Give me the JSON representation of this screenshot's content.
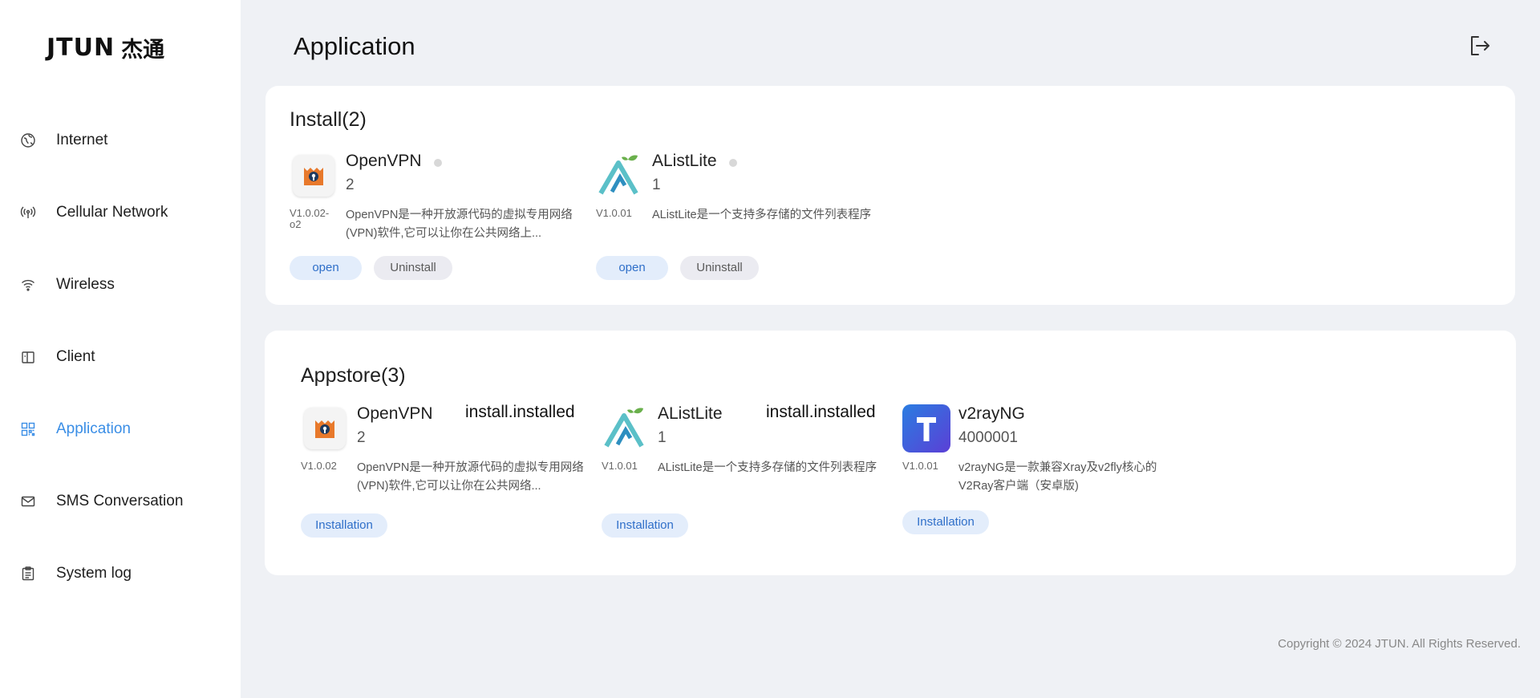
{
  "brand": {
    "logo_text": "JTUN",
    "logo_cn": "杰通"
  },
  "sidebar": {
    "items": [
      {
        "label": "Internet",
        "icon": "globe-icon"
      },
      {
        "label": "Cellular Network",
        "icon": "antenna-icon"
      },
      {
        "label": "Wireless",
        "icon": "wifi-icon"
      },
      {
        "label": "Client",
        "icon": "device-icon"
      },
      {
        "label": "Application",
        "icon": "grid-icon",
        "active": true
      },
      {
        "label": "SMS Conversation",
        "icon": "mail-icon"
      },
      {
        "label": "System log",
        "icon": "clipboard-icon"
      }
    ]
  },
  "header": {
    "title": "Application",
    "logout_icon": "logout-icon"
  },
  "installed": {
    "title": "Install(2)",
    "apps": [
      {
        "name": "OpenVPN",
        "count": "2",
        "version": "V1.0.02-o2",
        "description": "OpenVPN是一种开放源代码的虚拟专用网络(VPN)软件,它可以让你在公共网络上...",
        "open_label": "open",
        "uninstall_label": "Uninstall"
      },
      {
        "name": "AListLite",
        "count": "1",
        "version": "V1.0.01",
        "description": "AListLite是一个支持多存储的文件列表程序",
        "open_label": "open",
        "uninstall_label": "Uninstall"
      }
    ]
  },
  "appstore": {
    "title": "Appstore(3)",
    "apps": [
      {
        "name": "OpenVPN",
        "count": "2",
        "status": "install.installed",
        "version": "V1.0.02",
        "description": "OpenVPN是一种开放源代码的虚拟专用网络(VPN)软件,它可以让你在公共网络...",
        "install_label": "Installation"
      },
      {
        "name": "AListLite",
        "count": "1",
        "status": "install.installed",
        "version": "V1.0.01",
        "description": "AListLite是一个支持多存储的文件列表程序",
        "install_label": "Installation"
      },
      {
        "name": "v2rayNG",
        "count": "4000001",
        "version": "V1.0.01",
        "description": "v2rayNG是一款兼容Xray及v2fly核心的V2Ray客户端（安卓版)",
        "install_label": "Installation"
      }
    ]
  },
  "footer": {
    "copyright": "Copyright © 2024 JTUN. All Rights Reserved."
  },
  "colors": {
    "accent": "#3a8ee6",
    "background": "#eff1f5",
    "button_blue_bg": "#e3edfb"
  }
}
